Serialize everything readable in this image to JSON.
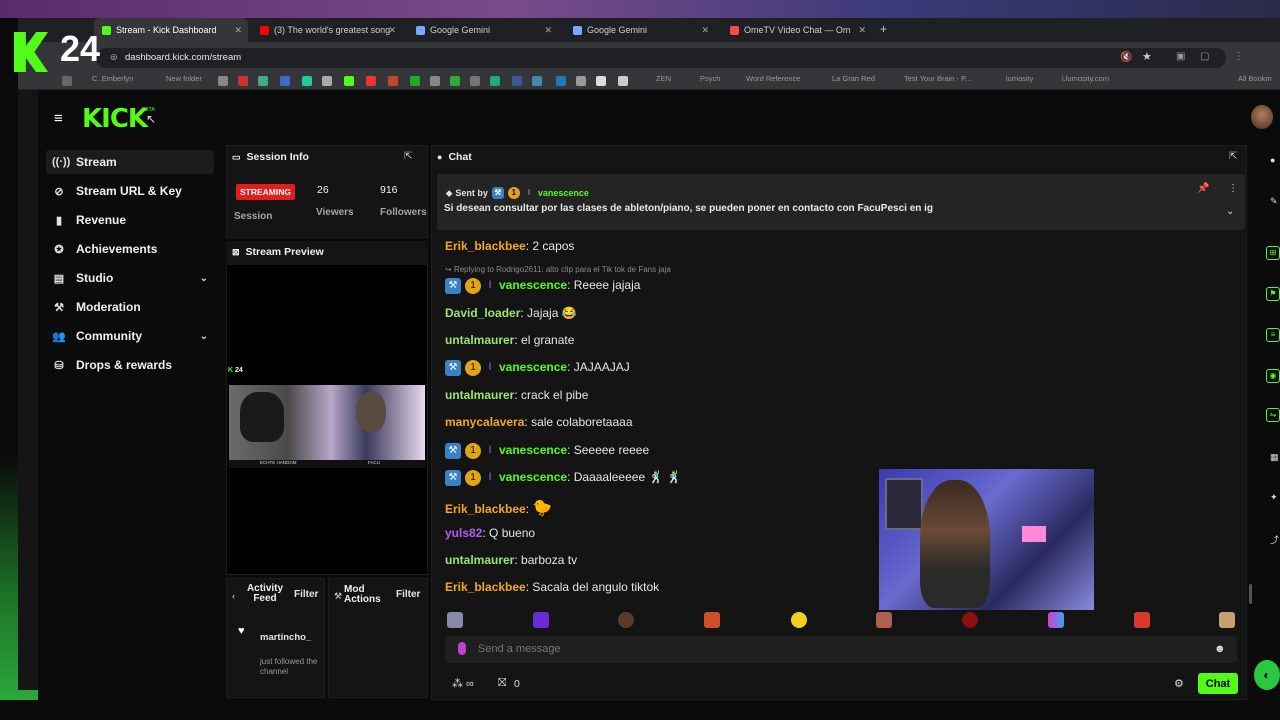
{
  "overlay_logo": {
    "text": "24"
  },
  "browser": {
    "tabs": [
      {
        "title": "Stream - Kick Dashboard",
        "favicon_color": "#53fc18"
      },
      {
        "title": "(3) The world's greatest song",
        "favicon_color": "#ff0000"
      },
      {
        "title": "Google Gemini",
        "favicon_color": "#7aa7ff"
      },
      {
        "title": "Google Gemini",
        "favicon_color": "#7aa7ff"
      },
      {
        "title": "OmeTV Video Chat — Om",
        "favicon_color": "#ff4a4a"
      }
    ],
    "new_tab": "+",
    "url": "dashboard.kick.com/stream",
    "bookmarks": [
      "C. Emberlyn",
      "New folder",
      "ZEN",
      "Psych",
      "Word Reference",
      "La Gran Red",
      "Test Your Brain - P...",
      "lumosity",
      "i.lumosity.com",
      "All Bookm"
    ]
  },
  "app": {
    "logo": "KICK",
    "logo_tag": "BETA",
    "nav": [
      {
        "label": "Stream",
        "icon": "stream-icon",
        "glyph": "((·))",
        "active": true,
        "expandable": false
      },
      {
        "label": "Stream URL & Key",
        "icon": "link-icon",
        "glyph": "⊘",
        "active": false,
        "expandable": false
      },
      {
        "label": "Revenue",
        "icon": "revenue-icon",
        "glyph": "▮",
        "active": false,
        "expandable": false
      },
      {
        "label": "Achievements",
        "icon": "achievements-icon",
        "glyph": "✪",
        "active": false,
        "expandable": false
      },
      {
        "label": "Studio",
        "icon": "studio-icon",
        "glyph": "▤",
        "active": false,
        "expandable": true
      },
      {
        "label": "Moderation",
        "icon": "moderation-icon",
        "glyph": "⚒",
        "active": false,
        "expandable": false
      },
      {
        "label": "Community",
        "icon": "community-icon",
        "glyph": "👥",
        "active": false,
        "expandable": true
      },
      {
        "label": "Drops & rewards",
        "icon": "drops-icon",
        "glyph": "⛁",
        "active": false,
        "expandable": false
      }
    ],
    "session": {
      "title": "Session Info",
      "status": "STREAMING",
      "status_label": "Session",
      "viewers": "26",
      "viewers_label": "Viewers",
      "followers": "916",
      "followers_label": "Followers"
    },
    "preview": {
      "title": "Stream Preview",
      "overlay_logo": "24",
      "caption_left": "ECHTE HANDOM",
      "caption_right": "FACU"
    },
    "activity": {
      "title": "Activity Feed",
      "filter": "Filter",
      "items": [
        {
          "user": "martincho_",
          "text": "just followed the channel"
        }
      ]
    },
    "mod_actions": {
      "title": "Mod Actions",
      "filter": "Filter"
    },
    "chat": {
      "title": "Chat",
      "pinned": {
        "sent_by_label": "Sent by",
        "user": "vanescence",
        "message": "Si desean consultar por las clases de ableton/piano, se pueden poner en contacto con FacuPesci en ig"
      },
      "messages": [
        {
          "user": "Erik_blackbee",
          "color": "orange",
          "text": "2 capos",
          "badges": false,
          "reply": ""
        },
        {
          "user": "vanescence",
          "color": "green",
          "text": "Reeee jajaja",
          "badges": true,
          "reply": "Replying to Rodrigo2611: alto clip para el Tik tok de Fans jaja"
        },
        {
          "user": "David_loader",
          "color": "lime",
          "text": "Jajaja 😂",
          "badges": false,
          "reply": ""
        },
        {
          "user": "untalmaurer",
          "color": "lime",
          "text": "el granate",
          "badges": false,
          "reply": ""
        },
        {
          "user": "vanescence",
          "color": "green",
          "text": "JAJAAJAJ",
          "badges": true,
          "reply": ""
        },
        {
          "user": "untalmaurer",
          "color": "lime",
          "text": "crack el pibe",
          "badges": false,
          "reply": ""
        },
        {
          "user": "manycalavera",
          "color": "orange",
          "text": "sale colaboretaaaa",
          "badges": false,
          "reply": ""
        },
        {
          "user": "vanescence",
          "color": "green",
          "text": "Seeeee reeee",
          "badges": true,
          "reply": ""
        },
        {
          "user": "vanescence",
          "color": "green",
          "text": "Daaaaleeeee 🕺 🕺",
          "badges": true,
          "reply": ""
        },
        {
          "user": "Erik_blackbee",
          "color": "orange",
          "text": "🐤",
          "badges": false,
          "reply": ""
        },
        {
          "user": "yuls82",
          "color": "purple",
          "text": "Q bueno",
          "badges": false,
          "reply": ""
        },
        {
          "user": "untalmaurer",
          "color": "lime",
          "text": "barboza tv",
          "badges": false,
          "reply": ""
        },
        {
          "user": "Erik_blackbee",
          "color": "orange",
          "text": "Sacala del angulo tiktok",
          "badges": false,
          "reply": ""
        }
      ],
      "input_placeholder": "Send a message",
      "footer_count": "0",
      "send_button": "Chat"
    }
  },
  "colors": {
    "accent": "#53fc18",
    "live": "#e11d1d"
  }
}
